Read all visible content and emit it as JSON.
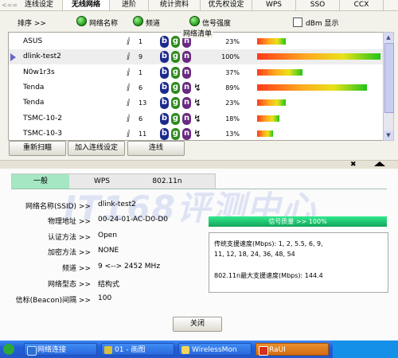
{
  "tabs": [
    "连线设定",
    "无线网络",
    "进阶",
    "统计资料",
    "优先权设定",
    "WPS",
    "SSO",
    "CCX"
  ],
  "tabs_active": 1,
  "back_arrow": "<==",
  "header": {
    "sort_label": "排序 >>",
    "col_ssid": "网络名称",
    "col_channel": "频道",
    "col_signal": "信号强度",
    "dbm_label": "dBm 显示",
    "list_caption": "网络清单"
  },
  "networks": [
    {
      "ssid": "ASUS",
      "channel": "1",
      "modes": [
        "b",
        "g",
        "n"
      ],
      "secured": false,
      "signal_pct": "23%",
      "signal": 0.23,
      "selected": false
    },
    {
      "ssid": "dlink-test2",
      "channel": "9",
      "modes": [
        "b",
        "g",
        "n"
      ],
      "secured": false,
      "signal_pct": "100%",
      "signal": 1.0,
      "selected": true
    },
    {
      "ssid": "N0w1r3s",
      "channel": "1",
      "modes": [
        "b",
        "g",
        "n"
      ],
      "secured": false,
      "signal_pct": "37%",
      "signal": 0.37,
      "selected": false
    },
    {
      "ssid": "Tenda",
      "channel": "6",
      "modes": [
        "b",
        "g",
        "n"
      ],
      "secured": true,
      "signal_pct": "89%",
      "signal": 0.89,
      "selected": false
    },
    {
      "ssid": "Tenda",
      "channel": "13",
      "modes": [
        "b",
        "g",
        "n"
      ],
      "secured": true,
      "signal_pct": "23%",
      "signal": 0.23,
      "selected": false
    },
    {
      "ssid": "TSMC-10-2",
      "channel": "6",
      "modes": [
        "b",
        "g",
        "n"
      ],
      "secured": true,
      "signal_pct": "18%",
      "signal": 0.18,
      "selected": false
    },
    {
      "ssid": "TSMC-10-3",
      "channel": "11",
      "modes": [
        "b",
        "g",
        "n"
      ],
      "secured": true,
      "signal_pct": "13%",
      "signal": 0.13,
      "selected": false
    }
  ],
  "buttons": {
    "rescan": "重新扫瞄",
    "add_profile": "加入连线设定",
    "connect": "连线",
    "close": "关闭"
  },
  "detail_tabs": [
    "一般",
    "WPS",
    "802.11n"
  ],
  "detail_tabs_active": 0,
  "watermark": "IT168评测中心",
  "details": [
    {
      "label": "网络名称(SSID) >>",
      "value": "dlink-test2"
    },
    {
      "label": "物理地址 >>",
      "value": "00-24-01-AC-D0-D0"
    },
    {
      "label": "认证方法 >>",
      "value": "Open"
    },
    {
      "label": "加密方法 >>",
      "value": "NONE"
    },
    {
      "label": "频道 >>",
      "value": "9 <--> 2452 MHz"
    },
    {
      "label": "网络型态 >>",
      "value": "结构式"
    },
    {
      "label": "信标(Beacon)间隔 >>",
      "value": "100"
    }
  ],
  "quality": {
    "text": "信号质量 >> 100%",
    "level": 1.0
  },
  "speed": {
    "legacy_line1": "传统支援速度(Mbps): 1, 2, 5.5, 6, 9,",
    "legacy_line2": "11, 12, 18, 24, 36, 48, 54",
    "n_max": "802.11n最大支援速度(Mbps): 144.4"
  },
  "taskbar": [
    {
      "label": "网络连接",
      "color": "#2f6fd1",
      "active": false
    },
    {
      "label": "01 - 画图",
      "color": "#d7c03a",
      "active": false
    },
    {
      "label": "WirelessMon",
      "color": "#f2d35b",
      "active": false
    },
    {
      "label": "RaUI",
      "color": "#d6321b",
      "active": true
    }
  ],
  "colors": {
    "selected_marker": "#6a66c6",
    "quality_bar": "#13a55a",
    "active_tab": "#a5e6c3"
  }
}
